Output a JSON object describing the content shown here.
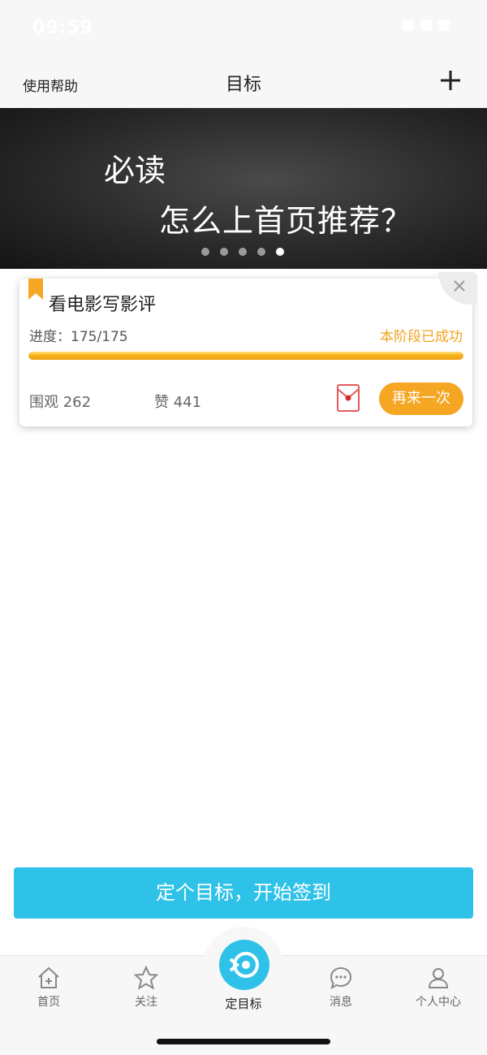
{
  "status_bar": {
    "time": "09:59"
  },
  "nav": {
    "help": "使用帮助",
    "title": "目标",
    "add_icon": "plus-icon"
  },
  "banner": {
    "line1": "必读",
    "line2": "怎么上首页推荐？",
    "dots_total": 5,
    "active_dot": 5
  },
  "goal_card": {
    "title": "看电影写影评",
    "progress_text": "进度：175/175",
    "progress_fraction": 1.0,
    "stage_status": "本阶段已成功",
    "views_label": "围观 262",
    "likes_label": "赞 441",
    "retry_label": "再来一次",
    "accent_color": "#f5a623"
  },
  "cta": {
    "label": "定个目标，开始签到",
    "color": "#2fc2e8"
  },
  "tab_bar": {
    "tabs": [
      {
        "label": "首页",
        "icon": "home-icon"
      },
      {
        "label": "关注",
        "icon": "star-icon"
      },
      {
        "label": "定目标",
        "icon": "target-icon"
      },
      {
        "label": "消息",
        "icon": "message-icon"
      },
      {
        "label": "个人中心",
        "icon": "person-icon"
      }
    ]
  }
}
